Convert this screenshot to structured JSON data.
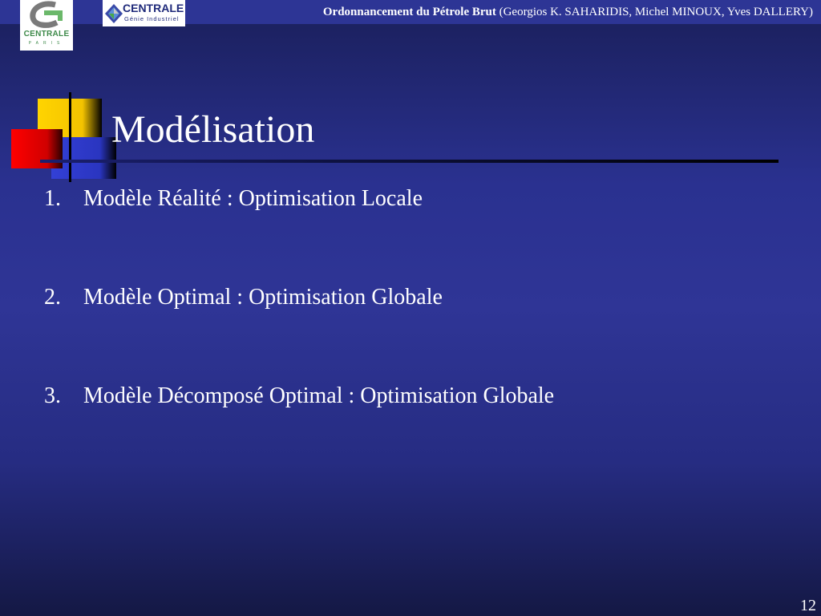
{
  "header": {
    "title_bold": "Ordonnancement du Pétrole Brut",
    "authors": "(Georgios K. SAHARIDIS, Michel MINOUX, Yves DALLERY)"
  },
  "logos": {
    "left": {
      "word": "CENTRALE",
      "sub": "PARIS"
    },
    "right": {
      "word": "CENTRALE",
      "sub": "Génie Industriel"
    }
  },
  "slide": {
    "title": "Modélisation",
    "items": [
      {
        "number": "1.",
        "text": "Modèle Réalité : Optimisation Locale"
      },
      {
        "number": "2.",
        "text": "Modèle Optimal : Optimisation Globale"
      },
      {
        "number": "3.",
        "text": "Modèle Décomposé Optimal : Optimisation Globale"
      }
    ],
    "page_number": "12"
  },
  "colors": {
    "background": "#2f3596",
    "header_bar": "#2d3595",
    "accent_yellow": "#ffd400",
    "accent_red": "#ff0000",
    "accent_blue": "#3340d6"
  }
}
